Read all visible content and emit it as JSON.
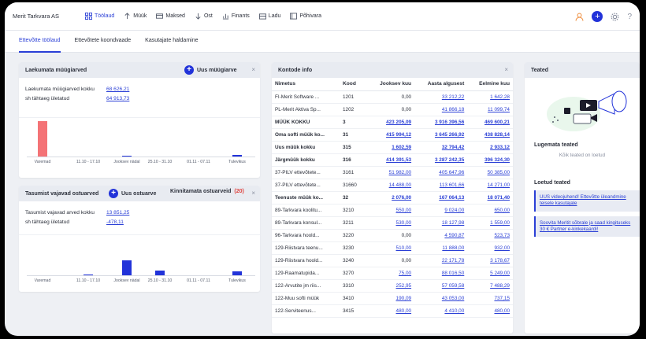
{
  "company": "Merit Tarkvara AS",
  "nav": [
    {
      "label": "Töölaud",
      "icon": "dashboard-icon",
      "active": true
    },
    {
      "label": "Müük",
      "icon": "arrow-up-icon",
      "active": false
    },
    {
      "label": "Maksed",
      "icon": "card-icon",
      "active": false
    },
    {
      "label": "Ost",
      "icon": "arrow-down-icon",
      "active": false
    },
    {
      "label": "Finants",
      "icon": "finance-icon",
      "active": false
    },
    {
      "label": "Ladu",
      "icon": "warehouse-icon",
      "active": false
    },
    {
      "label": "Põhivara",
      "icon": "assets-icon",
      "active": false
    }
  ],
  "top_right": {
    "user_icon": "user-icon",
    "add_icon": "+",
    "settings_icon": "gear-icon",
    "help_icon": "?"
  },
  "subtabs": [
    "Ettevõtte töölaud",
    "Ettevõtete koondvaade",
    "Kasutajate haldamine"
  ],
  "receivables": {
    "title": "Laekumata müügiarved",
    "action": "Uus müügiarve",
    "close": "×",
    "rows": [
      {
        "label": "Laekumata müügiarved kokku",
        "value": "68 626,21"
      },
      {
        "label": "sh tähtaeg ületatud",
        "value": "64 913,73"
      }
    ],
    "ticks": [
      "Varemad",
      "11.10 - 17.10",
      "Jooksev nädal",
      "25.10 - 31.10",
      "01.11 - 07.11",
      "Tulevikus"
    ],
    "bars": [
      {
        "value": 1.0,
        "color": "#f47376"
      },
      {
        "value": 0.0,
        "color": "#2233d9"
      },
      {
        "value": 0.02,
        "color": "#2233d9"
      },
      {
        "value": 0.0,
        "color": "#2233d9"
      },
      {
        "value": 0.0,
        "color": "#2233d9"
      },
      {
        "value": 0.05,
        "color": "#2233d9"
      }
    ]
  },
  "payables": {
    "title": "Tasumist vajavad ostuarved",
    "action": "Uus ostuarve",
    "confirm_label": "Kinnitamata ostuarveid",
    "confirm_count": "(20)",
    "close": "×",
    "rows": [
      {
        "label": "Tasumist vajavad arved kokku",
        "value": "13 851,25"
      },
      {
        "label": "sh tähtaeg ületatud",
        "value": "-478,11"
      }
    ],
    "ticks": [
      "Varemad",
      "11.10 - 17.10",
      "Jooksev nädal",
      "25.10 - 31.10",
      "01.11 - 07.11",
      "Tulevikus"
    ],
    "bars": [
      {
        "value": 0.0,
        "color": "#2233d9"
      },
      {
        "value": 0.02,
        "color": "#2233d9"
      },
      {
        "value": 0.4,
        "color": "#2233d9"
      },
      {
        "value": 0.12,
        "color": "#2233d9"
      },
      {
        "value": 0.0,
        "color": "#2233d9"
      },
      {
        "value": 0.1,
        "color": "#2233d9"
      }
    ]
  },
  "accounts": {
    "title": "Kontode info",
    "close": "×",
    "columns": [
      "Nimetus",
      "Kood",
      "Jooksev kuu",
      "Aasta algusest",
      "Eelmine kuu"
    ],
    "rows": [
      {
        "name": "FI-Merit Software ...",
        "code": "1201",
        "cur": "0,00",
        "ytd": "33 212,22",
        "prev": "1 642,28",
        "bold": false
      },
      {
        "name": "PL-Merit Aktiva Sp...",
        "code": "1202",
        "cur": "0,00",
        "ytd": "41 866,18",
        "prev": "11 099,74",
        "bold": false
      },
      {
        "name": "MÜÜK KOKKU",
        "code": "3",
        "cur": "423 205,09",
        "ytd": "3 916 396,56",
        "prev": "469 600,21",
        "bold": true
      },
      {
        "name": "Oma softi müük ko...",
        "code": "31",
        "cur": "415 994,12",
        "ytd": "3 645 266,92",
        "prev": "438 828,14",
        "bold": true
      },
      {
        "name": "Uus müük kokku",
        "code": "315",
        "cur": "1 602,59",
        "ytd": "32 794,42",
        "prev": "2 933,12",
        "bold": true
      },
      {
        "name": "Järgmüük kokku",
        "code": "316",
        "cur": "414 391,53",
        "ytd": "3 287 242,35",
        "prev": "396 324,30",
        "bold": true
      },
      {
        "name": "37-PILV ettevõtete...",
        "code": "3161",
        "cur": "51 982,00",
        "ytd": "405 647,96",
        "prev": "50 385,00",
        "bold": false
      },
      {
        "name": "37-PILV ettevõtete...",
        "code": "31660",
        "cur": "14 488,00",
        "ytd": "113 601,66",
        "prev": "14 271,00",
        "bold": false
      },
      {
        "name": "Teenuste müük ko...",
        "code": "32",
        "cur": "2 076,00",
        "ytd": "167 064,13",
        "prev": "18 071,40",
        "bold": true
      },
      {
        "name": "89-Tarkvara koolitu...",
        "code": "3210",
        "cur": "550,00",
        "ytd": "9 024,00",
        "prev": "650,00",
        "bold": false
      },
      {
        "name": "89-Tarkvara konsul...",
        "code": "3211",
        "cur": "530,00",
        "ytd": "18 127,98",
        "prev": "1 559,00",
        "bold": false
      },
      {
        "name": "96-Tarkvara hoold...",
        "code": "3220",
        "cur": "0,00",
        "ytd": "4 590,87",
        "prev": "523,73",
        "bold": false
      },
      {
        "name": "129-Riistvara teenu...",
        "code": "3230",
        "cur": "510,00",
        "ytd": "11 888,00",
        "prev": "932,00",
        "bold": false
      },
      {
        "name": "129-Riistvara hoold...",
        "code": "3240",
        "cur": "0,00",
        "ytd": "22 171,78",
        "prev": "3 178,67",
        "bold": false
      },
      {
        "name": "129-Raamatupida...",
        "code": "3270",
        "cur": "75,00",
        "ytd": "88 016,50",
        "prev": "5 249,00",
        "bold": false
      },
      {
        "name": "122-Arvutite jm riis...",
        "code": "3310",
        "cur": "252,95",
        "ytd": "57 059,58",
        "prev": "7 488,29",
        "bold": false
      },
      {
        "name": "122-Muu softi müük",
        "code": "3410",
        "cur": "190,09",
        "ytd": "43 053,00",
        "prev": "737,15",
        "bold": false
      },
      {
        "name": "122-Serviteenus...",
        "code": "3415",
        "cur": "480,00",
        "ytd": "4 410,00",
        "prev": "480,00",
        "bold": false
      }
    ]
  },
  "notifications": {
    "title": "Teated",
    "unread_title": "Lugemata teated",
    "all_read": "Kõik teated on loetud",
    "read_title": "Loetud teated",
    "items": [
      "UUS videojuhend! Ettevõtte üleandmine teisele kasutajale",
      "Soovita Meritit sõbrale ja saad kingituseks 30 € Partner e-kinkekaardi!"
    ]
  }
}
